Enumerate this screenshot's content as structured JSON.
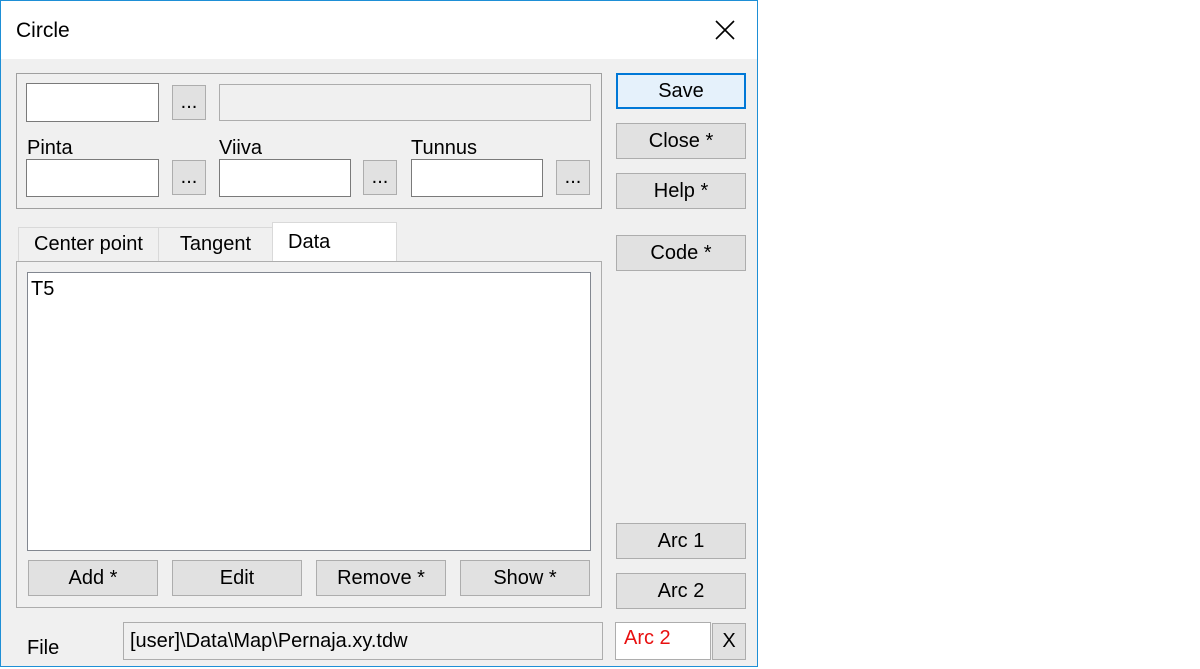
{
  "window": {
    "title": "Circle"
  },
  "top_group": {
    "field1_value": "",
    "field2_value": "",
    "pinta_label": "Pinta",
    "pinta_value": "",
    "viiva_label": "Viiva",
    "viiva_value": "",
    "tunnus_label": "Tunnus",
    "tunnus_value": "",
    "browse_label": "..."
  },
  "tabs": [
    {
      "label": "Center point",
      "active": false
    },
    {
      "label": "Tangent",
      "active": false
    },
    {
      "label": "Data",
      "active": true
    }
  ],
  "list": {
    "items": [
      "T5"
    ]
  },
  "list_buttons": {
    "add": "Add *",
    "edit": "Edit",
    "remove": "Remove *",
    "show": "Show *"
  },
  "side_buttons": {
    "save": "Save",
    "close": "Close *",
    "help": "Help *",
    "code": "Code *",
    "arc1": "Arc 1",
    "arc2": "Arc 2"
  },
  "footer": {
    "file_label": "File",
    "file_value": "[user]\\Data\\Map\\Pernaja.xy.tdw",
    "arc_value": "Arc 2",
    "clear_label": "X"
  },
  "colors": {
    "accent": "#0078d7",
    "window_border": "#1e8fd6",
    "arc_text": "#e81010"
  }
}
